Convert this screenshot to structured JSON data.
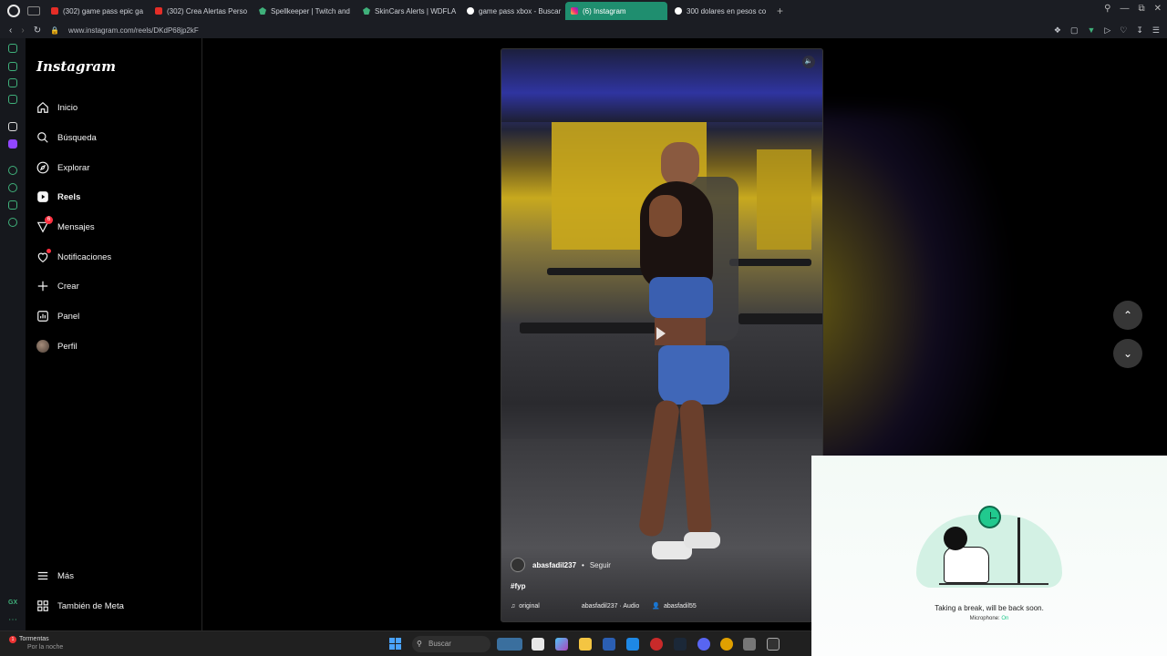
{
  "browser": {
    "tabs": [
      {
        "label": "(302) game pass epic ga",
        "favicon": "youtube-icon",
        "active": false
      },
      {
        "label": "(302) Crea Alertas Perso",
        "favicon": "youtube-icon",
        "active": false
      },
      {
        "label": "Spellkeeper | Twitch and",
        "favicon": "streamelements-icon",
        "active": false
      },
      {
        "label": "SkinCars Alerts | WDFLA",
        "favicon": "streamelements-icon",
        "active": false
      },
      {
        "label": "game pass xbox - Buscar",
        "favicon": "google-icon",
        "active": false
      },
      {
        "label": "(6) Instagram",
        "favicon": "instagram-icon",
        "active": true
      },
      {
        "label": "300 dolares en pesos co",
        "favicon": "google-icon",
        "active": false
      }
    ],
    "new_tab": "+",
    "url": "www.instagram.com/reels/DKdP68jp2kF"
  },
  "instagram": {
    "logo": "Instagram",
    "nav": [
      {
        "label": "Inicio",
        "icon": "home-icon"
      },
      {
        "label": "Búsqueda",
        "icon": "search-icon"
      },
      {
        "label": "Explorar",
        "icon": "compass-icon"
      },
      {
        "label": "Reels",
        "icon": "reels-icon"
      },
      {
        "label": "Mensajes",
        "icon": "messenger-icon",
        "badge": "6"
      },
      {
        "label": "Notificaciones",
        "icon": "heart-icon"
      },
      {
        "label": "Crear",
        "icon": "plus-icon"
      },
      {
        "label": "Panel",
        "icon": "chart-icon"
      },
      {
        "label": "Perfil",
        "icon": "avatar"
      }
    ],
    "more": "Más",
    "meta": "También de Meta"
  },
  "reel": {
    "username": "abasfadil237",
    "separator": "•",
    "follow": "Seguir",
    "caption": "#fyp",
    "audio": {
      "original": "original",
      "audio_credit": "abasfadil237 · Audio",
      "tagged_user": "abasfadil55"
    },
    "volume_icon": "volume-icon"
  },
  "break_overlay": {
    "title": "Taking a break, will be back soon.",
    "microphone_label": "Microphone:",
    "microphone_state": "On",
    "accent_color": "#21c98e"
  },
  "taskbar": {
    "weather_title": "Tormentas",
    "weather_subtitle": "Por la noche",
    "weather_badge": "1",
    "search_placeholder": "Buscar"
  }
}
